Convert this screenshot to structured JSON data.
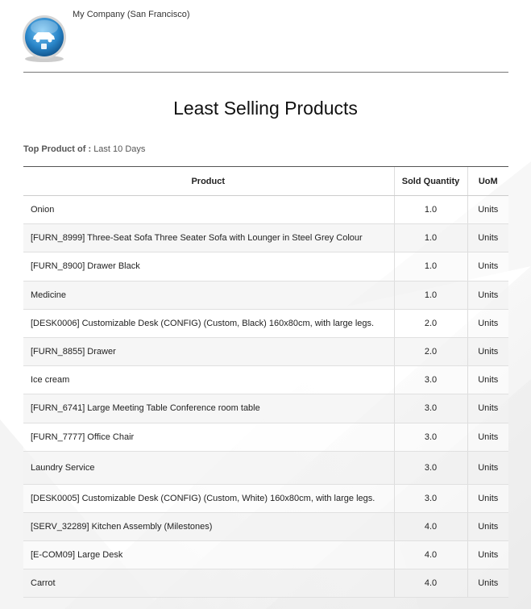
{
  "company": {
    "name": "My Company (San Francisco)"
  },
  "report": {
    "title": "Least Selling Products",
    "filter_label": "Top Product of :",
    "filter_value": "Last 10 Days"
  },
  "table": {
    "headers": {
      "product": "Product",
      "qty": "Sold Quantity",
      "uom": "UoM"
    },
    "rows": [
      {
        "product": "Onion",
        "qty": "1.0",
        "uom": "Units"
      },
      {
        "product": "[FURN_8999] Three-Seat Sofa Three Seater Sofa with Lounger in Steel Grey Colour",
        "qty": "1.0",
        "uom": "Units"
      },
      {
        "product": "[FURN_8900] Drawer Black",
        "qty": "1.0",
        "uom": "Units"
      },
      {
        "product": "Medicine",
        "qty": "1.0",
        "uom": "Units"
      },
      {
        "product": "[DESK0006] Customizable Desk (CONFIG) (Custom, Black) 160x80cm, with large legs.",
        "qty": "2.0",
        "uom": "Units"
      },
      {
        "product": "[FURN_8855] Drawer",
        "qty": "2.0",
        "uom": "Units"
      },
      {
        "product": "Ice cream",
        "qty": "3.0",
        "uom": "Units"
      },
      {
        "product": "[FURN_6741] Large Meeting Table Conference room table",
        "qty": "3.0",
        "uom": "Units"
      },
      {
        "product": "[FURN_7777] Office Chair",
        "qty": "3.0",
        "uom": "Units"
      },
      {
        "product": "Laundry Service",
        "qty": "3.0",
        "uom": "Units"
      },
      {
        "product": "[DESK0005] Customizable Desk (CONFIG) (Custom, White) 160x80cm, with large legs.",
        "qty": "3.0",
        "uom": "Units"
      },
      {
        "product": "[SERV_32289] Kitchen Assembly (Milestones)",
        "qty": "4.0",
        "uom": "Units"
      },
      {
        "product": "[E-COM09] Large Desk",
        "qty": "4.0",
        "uom": "Units"
      },
      {
        "product": "Carrot",
        "qty": "4.0",
        "uom": "Units"
      }
    ]
  }
}
